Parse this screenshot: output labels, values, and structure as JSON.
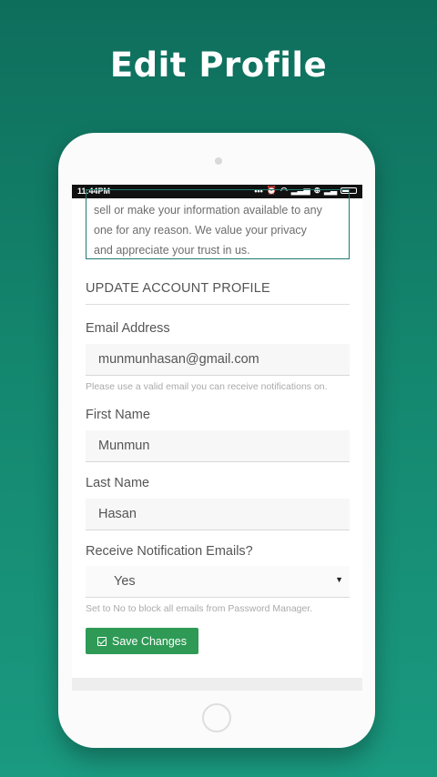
{
  "promo": {
    "title": "Edit Profile"
  },
  "status_bar": {
    "time": "11:44PM",
    "icons": [
      "more-icon",
      "alarm-icon",
      "wifi-icon",
      "signal-icon",
      "data-icon",
      "signal-2-icon",
      "battery-icon"
    ]
  },
  "privacy_notice": {
    "lines": [
      "sell or make your information available to any",
      "one for any reason. We value your privacy",
      "and appreciate your trust in us."
    ]
  },
  "section": {
    "heading": "UPDATE ACCOUNT PROFILE"
  },
  "form": {
    "email": {
      "label": "Email Address",
      "value": "munmunhasan@gmail.com",
      "help": "Please use a valid email you can receive notifications on."
    },
    "first_name": {
      "label": "First Name",
      "value": "Munmun"
    },
    "last_name": {
      "label": "Last Name",
      "value": "Hasan"
    },
    "notifications": {
      "label": "Receive Notification Emails?",
      "selected": "Yes",
      "help": "Set to No to block all emails from Password Manager."
    },
    "save_label": "Save Changes"
  },
  "colors": {
    "accent": "#1d7c70",
    "save_button": "#2e9a55",
    "background_top": "#0e6e5c",
    "background_bottom": "#1a9a80"
  }
}
